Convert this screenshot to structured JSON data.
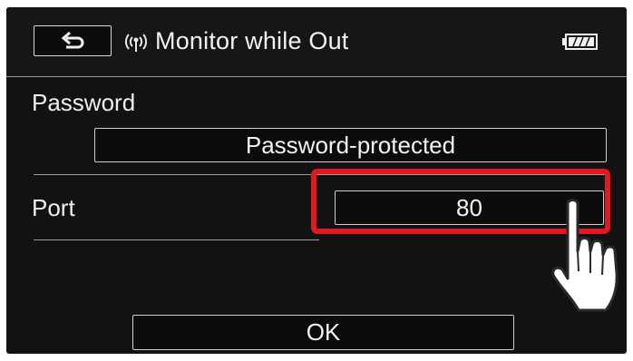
{
  "header": {
    "title": "Monitor while Out",
    "back_icon": "back-arrow-icon",
    "wifi_icon": "wifi-icon",
    "battery_icon": "battery-icon"
  },
  "password": {
    "label": "Password",
    "value": "Password-protected"
  },
  "port": {
    "label": "Port",
    "value": "80"
  },
  "ok_button": {
    "label": "OK"
  },
  "highlight_color": "#e01820",
  "pointer_icon": "tap-hand-icon"
}
